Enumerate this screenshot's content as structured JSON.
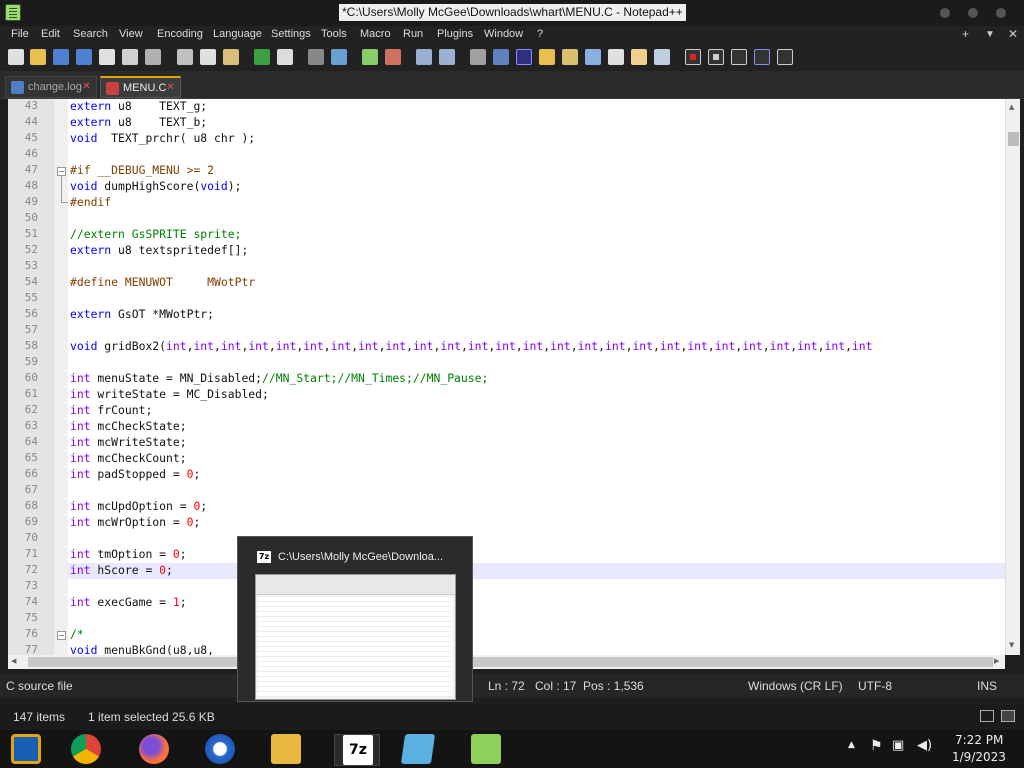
{
  "window": {
    "title": "*C:\\Users\\Molly McGee\\Downloads\\whart\\MENU.C - Notepad++"
  },
  "menu": {
    "items": [
      "File",
      "Edit",
      "Search",
      "View",
      "Encoding",
      "Language",
      "Settings",
      "Tools",
      "Macro",
      "Run",
      "Plugins",
      "Window",
      "?"
    ],
    "right": [
      "+",
      "▼",
      "✕"
    ]
  },
  "tabs": [
    {
      "label": "change.log"
    },
    {
      "label": "MENU.C"
    }
  ],
  "lines": [
    {
      "n": "43",
      "t": "extern u8    TEXT_g;"
    },
    {
      "n": "44",
      "t": "extern u8    TEXT_b;"
    },
    {
      "n": "45",
      "t": "void  TEXT_prchr( u8 chr );"
    },
    {
      "n": "46",
      "t": ""
    },
    {
      "n": "47",
      "t": "#if __DEBUG_MENU >= 2"
    },
    {
      "n": "48",
      "t": "void dumpHighScore(void);"
    },
    {
      "n": "49",
      "t": "#endif"
    },
    {
      "n": "50",
      "t": ""
    },
    {
      "n": "51",
      "t": "//extern GsSPRITE sprite;"
    },
    {
      "n": "52",
      "t": "extern u8 textspritedef[];"
    },
    {
      "n": "53",
      "t": ""
    },
    {
      "n": "54",
      "t": "#define MENUWOT     MWotPtr"
    },
    {
      "n": "55",
      "t": ""
    },
    {
      "n": "56",
      "t": "extern GsOT *MWotPtr;"
    },
    {
      "n": "57",
      "t": ""
    },
    {
      "n": "58",
      "t": "void gridBox2(int,int,int,int,int,int,int,int,int,int,int,int,int,int,int,int,int,int,int,int,int,int,int,int,int,int"
    },
    {
      "n": "59",
      "t": ""
    },
    {
      "n": "60",
      "t": "int menuState = MN_Disabled;//MN_Start;//MN_Times;//MN_Pause;"
    },
    {
      "n": "61",
      "t": "int writeState = MC_Disabled;"
    },
    {
      "n": "62",
      "t": "int frCount;"
    },
    {
      "n": "63",
      "t": "int mcCheckState;"
    },
    {
      "n": "64",
      "t": "int mcWriteState;"
    },
    {
      "n": "65",
      "t": "int mcCheckCount;"
    },
    {
      "n": "66",
      "t": "int padStopped = 0;"
    },
    {
      "n": "67",
      "t": ""
    },
    {
      "n": "68",
      "t": "int mcUpdOption = 0;"
    },
    {
      "n": "69",
      "t": "int mcWrOption = 0;"
    },
    {
      "n": "70",
      "t": ""
    },
    {
      "n": "71",
      "t": "int tmOption = 0;"
    },
    {
      "n": "72",
      "t": "int hScore = 0;"
    },
    {
      "n": "73",
      "t": ""
    },
    {
      "n": "74",
      "t": "int execGame = 1;"
    },
    {
      "n": "75",
      "t": ""
    },
    {
      "n": "76",
      "t": "/*"
    },
    {
      "n": "77",
      "t": "void menuBkGnd(u8,u8,"
    }
  ],
  "status": {
    "filetype": "C source file",
    "ln": "Ln : 72",
    "col": "Col : 17",
    "pos": "Pos : 1,536",
    "eol": "Windows (CR LF)",
    "enc": "UTF-8",
    "mode": "INS"
  },
  "explorer": {
    "items": "147 items",
    "selected": "1 item selected  25.6 KB"
  },
  "preview": {
    "title": "C:\\Users\\Molly McGee\\Downloa...",
    "icon": "7z"
  },
  "tray": {
    "time": "7:22 PM",
    "date": "1/9/2023"
  },
  "colors": {
    "keyword": "#0000ff",
    "type": "#8000ff",
    "preproc": "#804000",
    "comment": "#008000",
    "number": "#ff0000"
  }
}
